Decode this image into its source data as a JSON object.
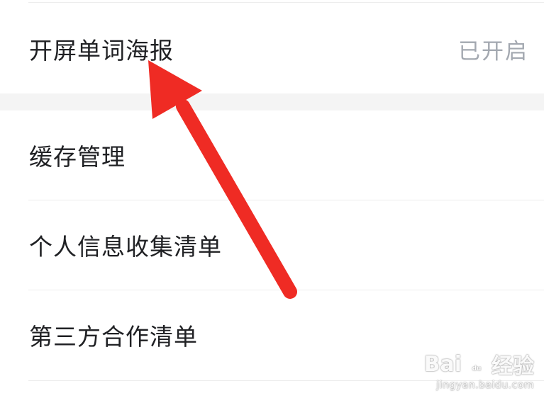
{
  "settings": {
    "rows": [
      {
        "label": "开屏单词海报",
        "value": "已开启"
      },
      {
        "label": "缓存管理"
      },
      {
        "label": "个人信息收集清单"
      },
      {
        "label": "第三方合作清单"
      }
    ]
  },
  "annotation": {
    "arrow_color": "#ef2b24"
  },
  "watermark": {
    "brand_prefix": "Bai",
    "brand_suffix": "经验",
    "url": "jingyan.baidu.com"
  }
}
